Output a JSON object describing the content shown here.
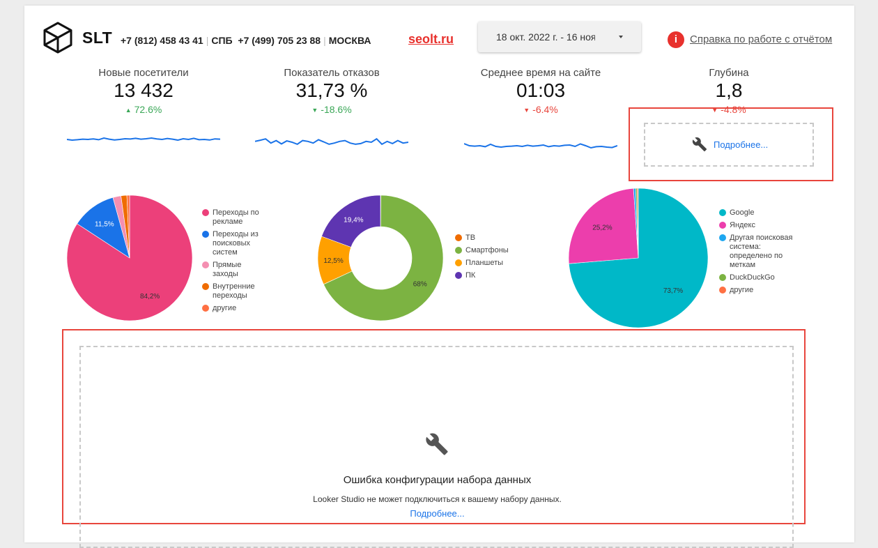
{
  "header": {
    "brand": "SLT",
    "phone1": "+7 (812) 458 43 41",
    "sep1": "|",
    "city1": "СПБ",
    "phone2": "+7 (499) 705 23 88",
    "sep2": "|",
    "city2": "МОСКВА",
    "site": "seolt.ru",
    "date_range": "18 окт. 2022 г. - 16 ноя. 2022 г.",
    "help_icon": "i",
    "help_link": "Справка по работе с отчётом"
  },
  "scorecards": [
    {
      "label": "Новые посетители",
      "value": "13 432",
      "delta": "72.6%",
      "arrow": "▲",
      "trend": "up",
      "spark": [
        0.4,
        0.45,
        0.42,
        0.38,
        0.4,
        0.36,
        0.42,
        0.3,
        0.38,
        0.44,
        0.4,
        0.35,
        0.37,
        0.32,
        0.38,
        0.35,
        0.3,
        0.36,
        0.4,
        0.33,
        0.38,
        0.45,
        0.35,
        0.4,
        0.32,
        0.42,
        0.4,
        0.44,
        0.36,
        0.38
      ]
    },
    {
      "label": "Показатель отказов",
      "value": "31,73 %",
      "delta": "-18.6%",
      "arrow": "▼",
      "trend": "up",
      "spark": [
        0.45,
        0.38,
        0.3,
        0.55,
        0.4,
        0.6,
        0.42,
        0.5,
        0.62,
        0.4,
        0.45,
        0.55,
        0.35,
        0.48,
        0.62,
        0.55,
        0.45,
        0.4,
        0.55,
        0.62,
        0.58,
        0.45,
        0.5,
        0.3,
        0.62,
        0.45,
        0.58,
        0.4,
        0.55,
        0.5
      ]
    },
    {
      "label": "Среднее время на сайте",
      "value": "01:03",
      "delta": "-6.4%",
      "arrow": "▼",
      "trend": "down",
      "spark": [
        0.4,
        0.55,
        0.58,
        0.55,
        0.62,
        0.45,
        0.6,
        0.65,
        0.6,
        0.58,
        0.55,
        0.6,
        0.52,
        0.58,
        0.55,
        0.5,
        0.62,
        0.55,
        0.58,
        0.52,
        0.5,
        0.6,
        0.42,
        0.55,
        0.7,
        0.62,
        0.6,
        0.65,
        0.68,
        0.55
      ]
    },
    {
      "label": "Глубина",
      "value": "1,8",
      "delta": "-4.8%",
      "arrow": "▼",
      "trend": "down"
    }
  ],
  "widget_error_small": {
    "link": "Подробнее..."
  },
  "pie_charts": [
    {
      "type": "pie",
      "slices": [
        {
          "name": "Переходы по рекламе",
          "value": 84.2,
          "color": "#ec407a",
          "label": "84,2%"
        },
        {
          "name": "Переходы из поисковых систем",
          "value": 11.5,
          "color": "#1a73e8",
          "label": "11,5%"
        },
        {
          "name": "Прямые заходы",
          "value": 2.1,
          "color": "#f48fb1",
          "label": ""
        },
        {
          "name": "Внутренние переходы",
          "value": 1.5,
          "color": "#ef6c00",
          "label": ""
        },
        {
          "name": "другие",
          "value": 0.7,
          "color": "#ff7043",
          "label": ""
        }
      ]
    },
    {
      "type": "donut",
      "slices": [
        {
          "name": "ТВ",
          "value": 0.1,
          "color": "#ef6c00",
          "label": ""
        },
        {
          "name": "Смартфоны",
          "value": 68,
          "color": "#7cb342",
          "label": "68%"
        },
        {
          "name": "Планшеты",
          "value": 12.5,
          "color": "#ffa000",
          "label": "12,5%"
        },
        {
          "name": "ПК",
          "value": 19.4,
          "color": "#5e35b1",
          "label": "19,4%"
        }
      ]
    },
    {
      "type": "pie",
      "slices": [
        {
          "name": "Google",
          "value": 73.7,
          "color": "#00b8c8",
          "label": "73,7%"
        },
        {
          "name": "Яндекс",
          "value": 25.2,
          "color": "#ec3eac",
          "label": "25,2%"
        },
        {
          "name": "Другая поисковая система: определено по меткам",
          "value": 0.5,
          "color": "#1ea7f0",
          "label": ""
        },
        {
          "name": "DuckDuckGo",
          "value": 0.35,
          "color": "#7cb342",
          "label": ""
        },
        {
          "name": "другие",
          "value": 0.25,
          "color": "#ff7043",
          "label": ""
        }
      ]
    }
  ],
  "widget_error_large": {
    "title": "Ошибка конфигурации набора данных",
    "message": "Looker Studio не может подключиться к вашему набору данных.",
    "link": "Подробнее..."
  }
}
